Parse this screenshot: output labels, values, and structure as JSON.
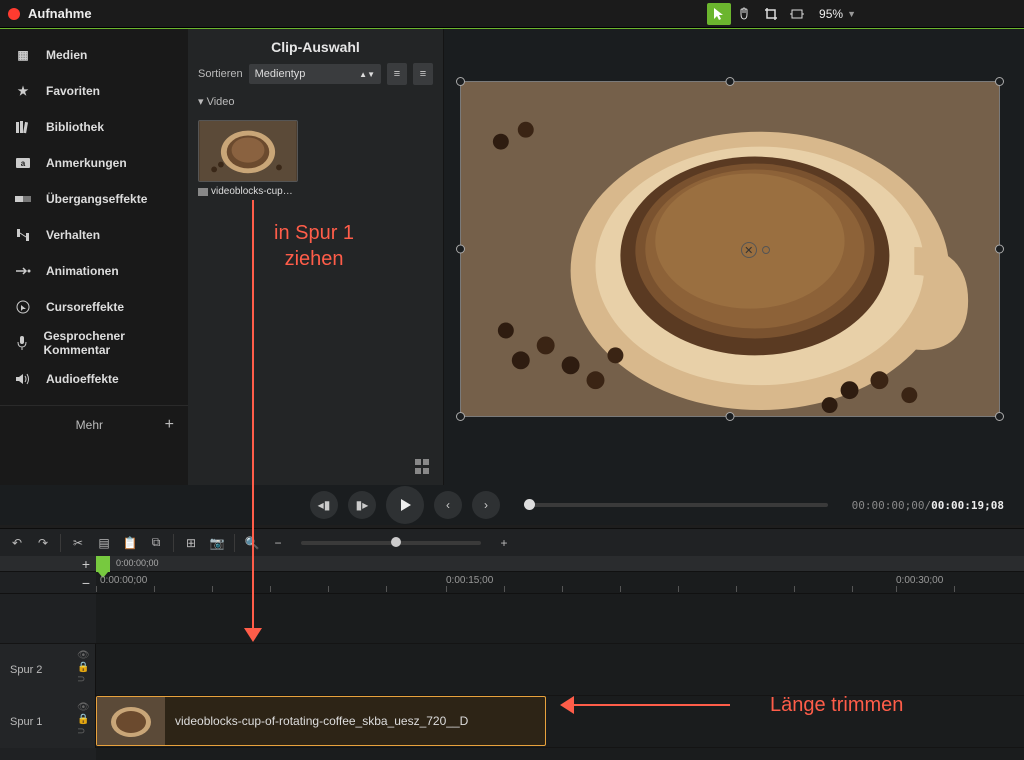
{
  "topbar": {
    "title": "Aufnahme",
    "zoom": "95%"
  },
  "sidebar": {
    "items": [
      {
        "icon": "grid",
        "label": "Medien"
      },
      {
        "icon": "star",
        "label": "Favoriten"
      },
      {
        "icon": "books",
        "label": "Bibliothek"
      },
      {
        "icon": "note",
        "label": "Anmerkungen"
      },
      {
        "icon": "trans",
        "label": "Übergangseffekte"
      },
      {
        "icon": "behave",
        "label": "Verhalten"
      },
      {
        "icon": "anim",
        "label": "Animationen"
      },
      {
        "icon": "cursor",
        "label": "Cursoreffekte"
      },
      {
        "icon": "mic",
        "label": "Gesprochener Kommentar"
      },
      {
        "icon": "audio",
        "label": "Audioeffekte"
      }
    ],
    "more": "Mehr"
  },
  "clipPanel": {
    "title": "Clip-Auswahl",
    "sortLabel": "Sortieren",
    "sortValue": "Medientyp",
    "treeNode": "Video",
    "thumbLabel": "videoblocks-cup…"
  },
  "playbar": {
    "timecode_current": "00:00:00;00",
    "timecode_total": "00:00:19;08"
  },
  "timeline": {
    "miniStart": "0:00:00;00",
    "rulerStart": "0:00:00;00",
    "ticks": [
      "0:00:15;00",
      "0:00:30;00"
    ],
    "track2": "Spur 2",
    "track1": "Spur 1",
    "clipLabel": "videoblocks-cup-of-rotating-coffee_skba_uesz_720__D"
  },
  "annotations": {
    "dragText": "in Spur 1\nziehen",
    "trimText": "Länge trimmen"
  }
}
